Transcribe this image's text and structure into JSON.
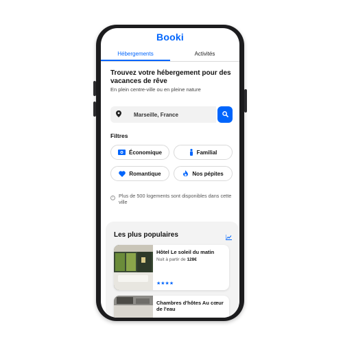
{
  "app": {
    "logo": "Booki",
    "brand_color": "#0065fc"
  },
  "tabs": [
    {
      "label": "Hébergements",
      "active": true
    },
    {
      "label": "Activités",
      "active": false
    }
  ],
  "hero": {
    "headline": "Trouvez votre hébergement pour des vacances de rêve",
    "subtitle": "En plein centre-ville ou en pleine nature"
  },
  "search": {
    "value": "Marseille, France",
    "location_icon": "map-pin-icon",
    "button_icon": "search-icon"
  },
  "filters": {
    "label": "Filtres",
    "items": [
      {
        "label": "Économique",
        "icon": "money-icon"
      },
      {
        "label": "Familial",
        "icon": "person-icon"
      },
      {
        "label": "Romantique",
        "icon": "heart-icon"
      },
      {
        "label": "Nos pépites",
        "icon": "fire-icon"
      }
    ]
  },
  "info": {
    "text": "Plus de 500 logements sont disponibles dans cette ville"
  },
  "popular": {
    "title": "Les plus populaires",
    "icon": "chart-icon",
    "cards": [
      {
        "title": "Hôtel Le soleil du matin",
        "price_prefix": "Nuit à partir de ",
        "price": "128€",
        "rating": 4,
        "stars": "★★★★"
      },
      {
        "title": "Chambres d'hôtes Au cœur de l'eau"
      }
    ]
  }
}
